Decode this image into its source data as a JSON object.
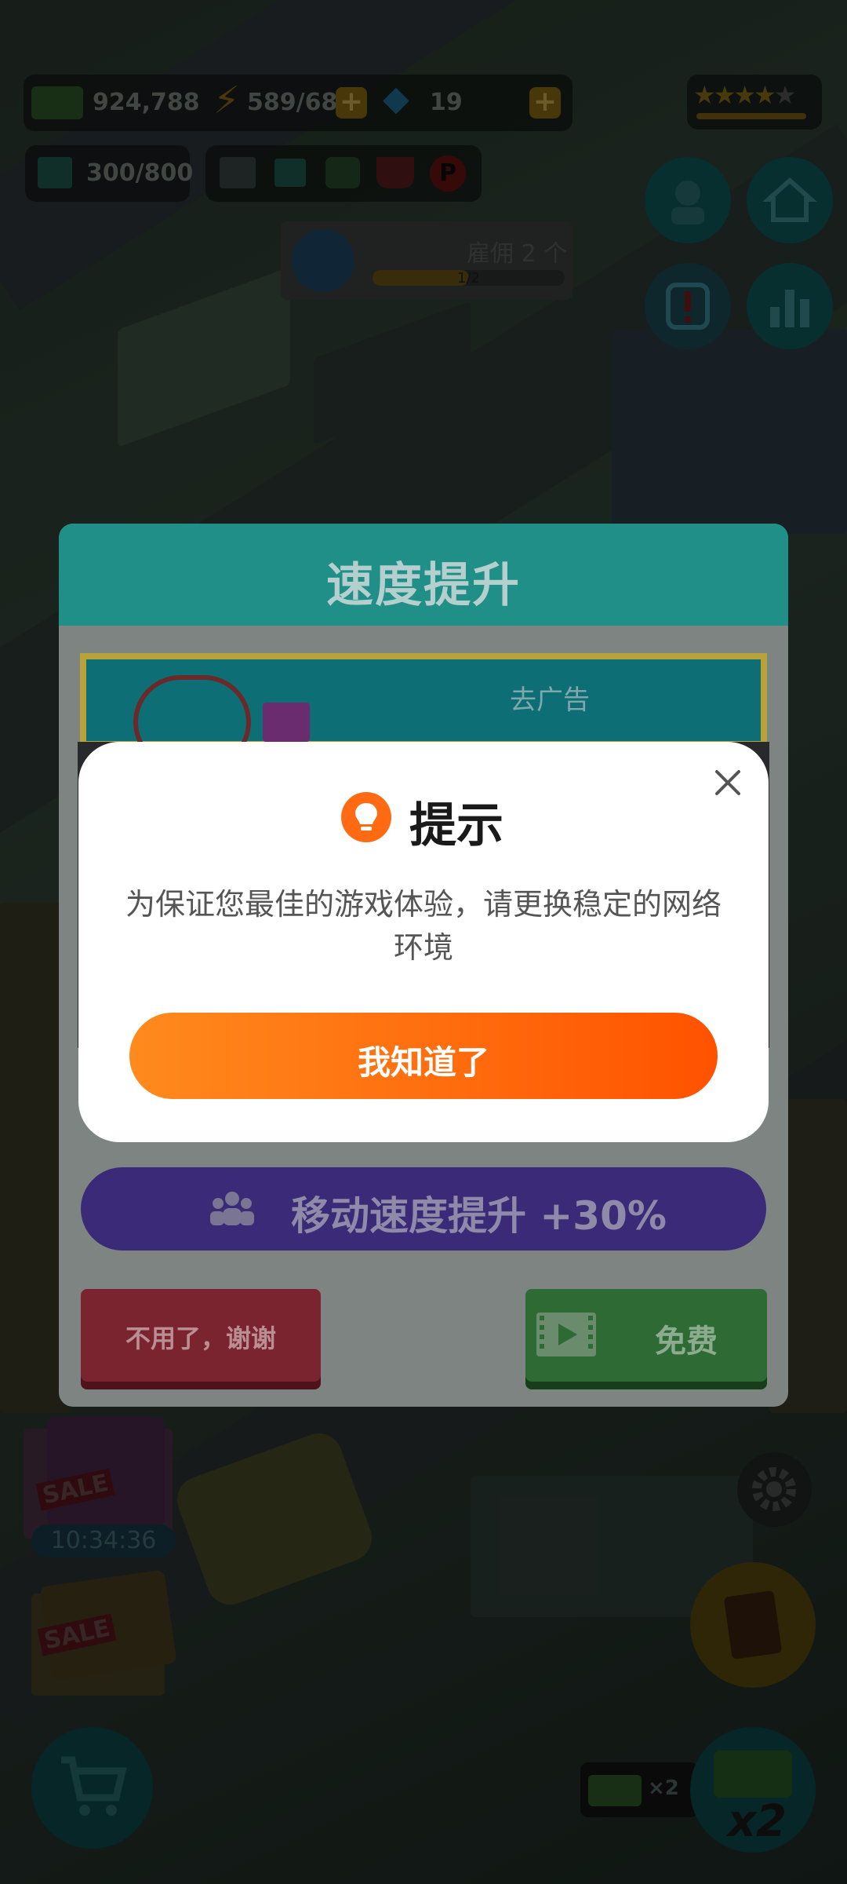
{
  "hud": {
    "cash": "924,788",
    "energy": "589/680",
    "gems": "19",
    "storage": "300/800",
    "hire_label": "雇佣 2 个",
    "hire_progress": "1/2",
    "sale_timer": "10:34:36",
    "sale_label_1": "SALE",
    "sale_label_2": "SALE",
    "cash_multiplier": "×2",
    "big_multiplier": "x2",
    "rating_stars": 4
  },
  "panel": {
    "title": "速度提升",
    "ad_banner_text": "去广告",
    "boost_text": "移动速度提升 +30%",
    "decline_button": "不用了，谢谢",
    "free_button": "免费"
  },
  "dialog": {
    "title": "提示",
    "message": "为保证您最佳的游戏体验，请更换稳定的网络环境",
    "confirm_button": "我知道了"
  },
  "colors": {
    "accent_orange": "#ff6f0f",
    "panel_header": "#1f8f88",
    "boost_purple": "#3b2a78"
  }
}
